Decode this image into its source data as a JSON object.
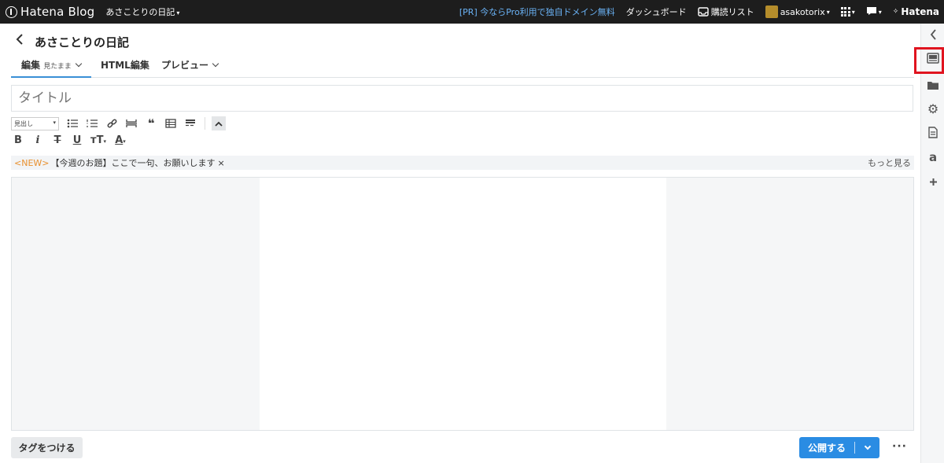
{
  "topbar": {
    "brand": "Hatena Blog",
    "blog_switch": "あさことりの日記",
    "pr_link": "[PR] 今ならPro利用で独自ドメイン無料",
    "dashboard": "ダッシュボード",
    "reading_list": "購読リスト",
    "username": "asakotorix",
    "hatena": "Hatena"
  },
  "header": {
    "blog_title": "あさことりの日記"
  },
  "tabs": {
    "edit_label": "編集",
    "edit_mode": "見たまま",
    "html_label": "HTML編集",
    "preview_label": "プレビュー"
  },
  "title_field": {
    "placeholder": "タイトル",
    "value": ""
  },
  "toolbar": {
    "heading_select": "見出し",
    "bold": "B",
    "italic": "i",
    "strike": "T",
    "underline": "U",
    "size": "тT",
    "color": "A"
  },
  "notice": {
    "badge": "<NEW>",
    "text": "【今週のお題】ここで一句、お願いします",
    "close": "×",
    "more": "もっと見る"
  },
  "footer": {
    "tag_button": "タグをつける",
    "publish_button": "公開する",
    "more": "···"
  },
  "colors": {
    "topbar_bg": "#1d1d1d",
    "pr_link": "#6ab2f5",
    "accent": "#2a8ce3",
    "notice_new": "#e8902e",
    "highlight": "#e0141f"
  },
  "sidebar": {
    "icons": [
      "chevron-left-icon",
      "photo-upload-icon",
      "folder-icon",
      "gear-icon",
      "document-icon",
      "amazon-icon",
      "plus-icon"
    ]
  }
}
